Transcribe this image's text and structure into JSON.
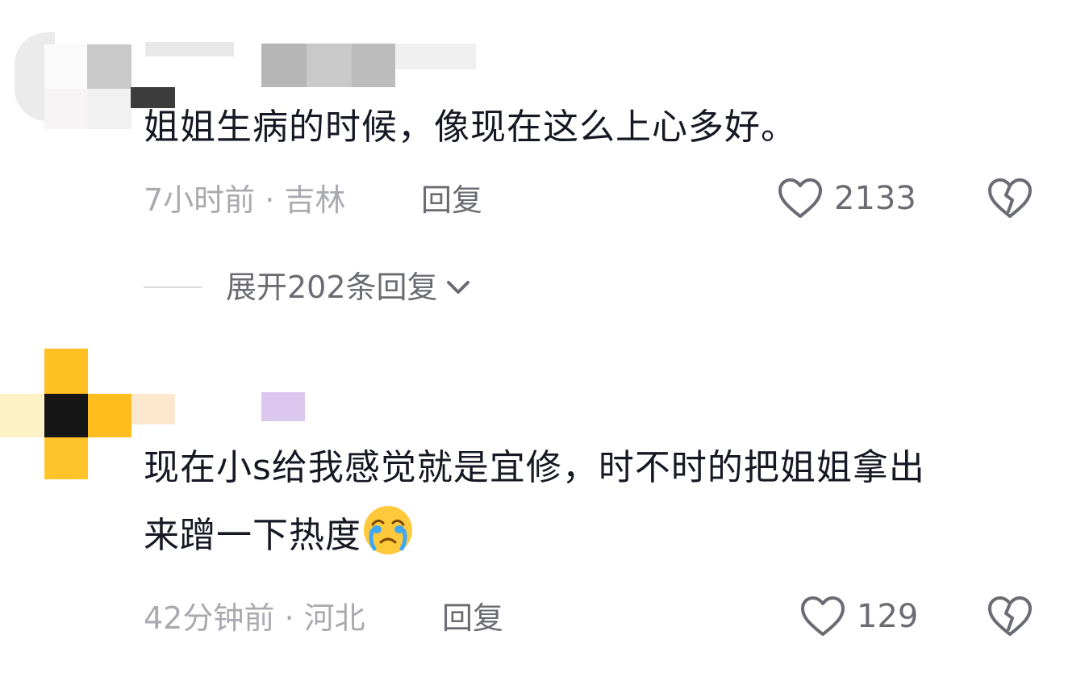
{
  "comments": [
    {
      "text_lines": [
        "姐姐生病的时候，像现在这么上心多好。"
      ],
      "time": "7小时前",
      "location": "吉林",
      "meta_separator": "·",
      "reply_label": "回复",
      "like_count": "2133",
      "expand_replies_label": "展开202条回复"
    },
    {
      "text_lines": [
        "现在小s给我感觉就是宜修，时不时的把姐姐拿出",
        "来蹭一下热度"
      ],
      "emoji": "crying-face-emoji",
      "time": "42分钟前",
      "location": "河北",
      "meta_separator": "·",
      "reply_label": "回复",
      "like_count": "129"
    }
  ],
  "icons": {
    "like": "heart-outline-icon",
    "dislike": "broken-heart-icon",
    "expand": "chevron-down-icon"
  },
  "colors": {
    "text_primary": "#161823",
    "text_secondary": "#a9aab0",
    "action_gray": "#6b6c73",
    "emoji_yellow": "#ffc93c",
    "emoji_tear": "#3fa7f5"
  }
}
